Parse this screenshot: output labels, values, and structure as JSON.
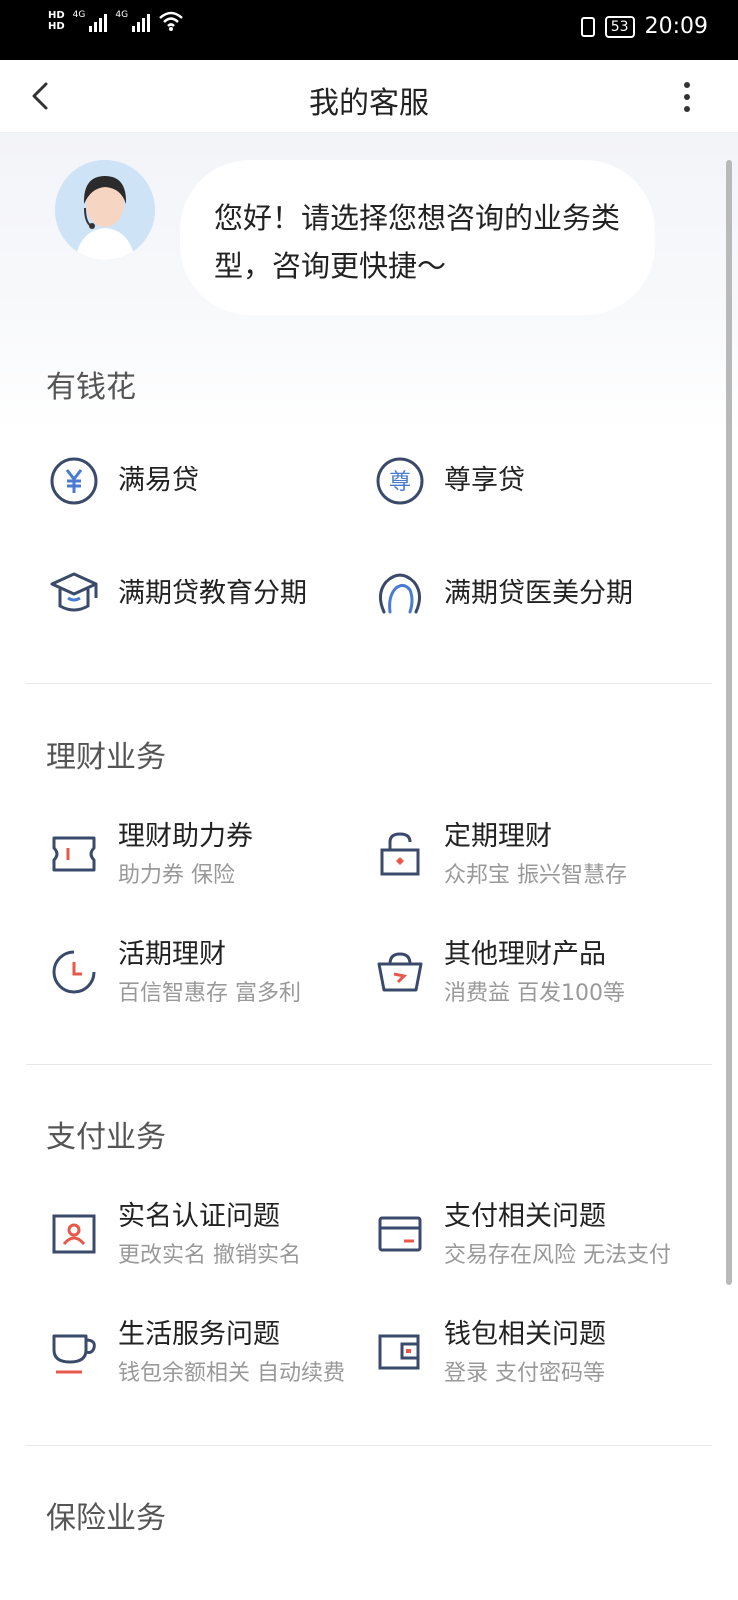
{
  "status_bar": {
    "hd1": "HD",
    "hd2": "HD",
    "net1": "4G",
    "net2": "4G",
    "battery": "53",
    "time": "20:09"
  },
  "nav": {
    "title": "我的客服"
  },
  "greeting": {
    "text": "您好！请选择您想咨询的业务类型，咨询更快捷～"
  },
  "sections": [
    {
      "title": "有钱花",
      "items": [
        {
          "label": "满易贷",
          "icon": "yen-circle-icon"
        },
        {
          "label": "尊享贷",
          "icon": "zun-circle-icon",
          "icon_text": "尊"
        },
        {
          "label": "满期贷教育分期",
          "icon": "graduation-cap-icon"
        },
        {
          "label": "满期贷医美分期",
          "icon": "face-icon"
        }
      ]
    },
    {
      "title": "理财业务",
      "items": [
        {
          "label": "理财助力券",
          "sub": "助力券 保险",
          "icon": "coupon-icon"
        },
        {
          "label": "定期理财",
          "sub": "众邦宝 振兴智慧存",
          "icon": "lock-icon"
        },
        {
          "label": "活期理财",
          "sub": "百信智惠存 富多利",
          "icon": "clock-icon"
        },
        {
          "label": "其他理财产品",
          "sub": "消费益 百发100等",
          "icon": "basket-icon"
        }
      ]
    },
    {
      "title": "支付业务",
      "items": [
        {
          "label": "实名认证问题",
          "sub": "更改实名 撤销实名",
          "icon": "id-card-icon"
        },
        {
          "label": "支付相关问题",
          "sub": "交易存在风险 无法支付",
          "icon": "bank-card-icon"
        },
        {
          "label": "生活服务问题",
          "sub": "钱包余额相关 自动续费",
          "icon": "cup-icon"
        },
        {
          "label": "钱包相关问题",
          "sub": "登录 支付密码等",
          "icon": "wallet-icon"
        }
      ]
    },
    {
      "title": "保险业务",
      "items": []
    }
  ],
  "colors": {
    "icon_primary": "#3a4a6b",
    "icon_accent": "#e8584a",
    "icon_blue": "#4a7bd0"
  }
}
